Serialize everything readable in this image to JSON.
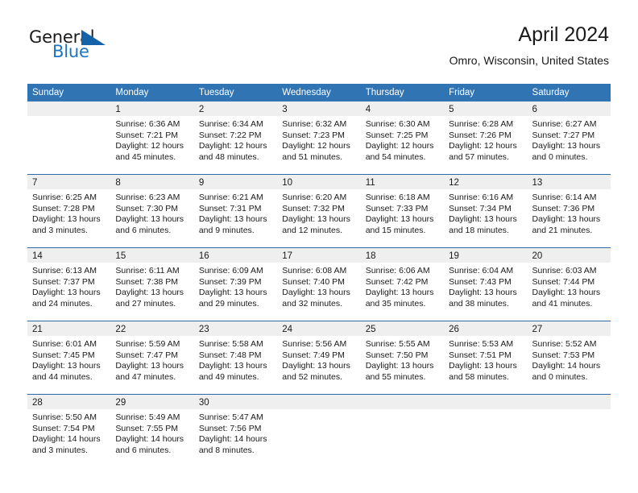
{
  "brand": {
    "name_top": "General",
    "name_bottom": "Blue",
    "accent_color": "#1e73be",
    "flag_color": "#1463a8"
  },
  "header": {
    "title": "April 2024",
    "location": "Omro, Wisconsin, United States"
  },
  "calendar": {
    "header_bg": "#3174b4",
    "day_band_bg": "#efefef",
    "weekdays": [
      "Sunday",
      "Monday",
      "Tuesday",
      "Wednesday",
      "Thursday",
      "Friday",
      "Saturday"
    ],
    "weeks": [
      [
        {
          "day": "",
          "lines": []
        },
        {
          "day": "1",
          "lines": [
            "Sunrise: 6:36 AM",
            "Sunset: 7:21 PM",
            "Daylight: 12 hours",
            "and 45 minutes."
          ]
        },
        {
          "day": "2",
          "lines": [
            "Sunrise: 6:34 AM",
            "Sunset: 7:22 PM",
            "Daylight: 12 hours",
            "and 48 minutes."
          ]
        },
        {
          "day": "3",
          "lines": [
            "Sunrise: 6:32 AM",
            "Sunset: 7:23 PM",
            "Daylight: 12 hours",
            "and 51 minutes."
          ]
        },
        {
          "day": "4",
          "lines": [
            "Sunrise: 6:30 AM",
            "Sunset: 7:25 PM",
            "Daylight: 12 hours",
            "and 54 minutes."
          ]
        },
        {
          "day": "5",
          "lines": [
            "Sunrise: 6:28 AM",
            "Sunset: 7:26 PM",
            "Daylight: 12 hours",
            "and 57 minutes."
          ]
        },
        {
          "day": "6",
          "lines": [
            "Sunrise: 6:27 AM",
            "Sunset: 7:27 PM",
            "Daylight: 13 hours",
            "and 0 minutes."
          ]
        }
      ],
      [
        {
          "day": "7",
          "lines": [
            "Sunrise: 6:25 AM",
            "Sunset: 7:28 PM",
            "Daylight: 13 hours",
            "and 3 minutes."
          ]
        },
        {
          "day": "8",
          "lines": [
            "Sunrise: 6:23 AM",
            "Sunset: 7:30 PM",
            "Daylight: 13 hours",
            "and 6 minutes."
          ]
        },
        {
          "day": "9",
          "lines": [
            "Sunrise: 6:21 AM",
            "Sunset: 7:31 PM",
            "Daylight: 13 hours",
            "and 9 minutes."
          ]
        },
        {
          "day": "10",
          "lines": [
            "Sunrise: 6:20 AM",
            "Sunset: 7:32 PM",
            "Daylight: 13 hours",
            "and 12 minutes."
          ]
        },
        {
          "day": "11",
          "lines": [
            "Sunrise: 6:18 AM",
            "Sunset: 7:33 PM",
            "Daylight: 13 hours",
            "and 15 minutes."
          ]
        },
        {
          "day": "12",
          "lines": [
            "Sunrise: 6:16 AM",
            "Sunset: 7:34 PM",
            "Daylight: 13 hours",
            "and 18 minutes."
          ]
        },
        {
          "day": "13",
          "lines": [
            "Sunrise: 6:14 AM",
            "Sunset: 7:36 PM",
            "Daylight: 13 hours",
            "and 21 minutes."
          ]
        }
      ],
      [
        {
          "day": "14",
          "lines": [
            "Sunrise: 6:13 AM",
            "Sunset: 7:37 PM",
            "Daylight: 13 hours",
            "and 24 minutes."
          ]
        },
        {
          "day": "15",
          "lines": [
            "Sunrise: 6:11 AM",
            "Sunset: 7:38 PM",
            "Daylight: 13 hours",
            "and 27 minutes."
          ]
        },
        {
          "day": "16",
          "lines": [
            "Sunrise: 6:09 AM",
            "Sunset: 7:39 PM",
            "Daylight: 13 hours",
            "and 29 minutes."
          ]
        },
        {
          "day": "17",
          "lines": [
            "Sunrise: 6:08 AM",
            "Sunset: 7:40 PM",
            "Daylight: 13 hours",
            "and 32 minutes."
          ]
        },
        {
          "day": "18",
          "lines": [
            "Sunrise: 6:06 AM",
            "Sunset: 7:42 PM",
            "Daylight: 13 hours",
            "and 35 minutes."
          ]
        },
        {
          "day": "19",
          "lines": [
            "Sunrise: 6:04 AM",
            "Sunset: 7:43 PM",
            "Daylight: 13 hours",
            "and 38 minutes."
          ]
        },
        {
          "day": "20",
          "lines": [
            "Sunrise: 6:03 AM",
            "Sunset: 7:44 PM",
            "Daylight: 13 hours",
            "and 41 minutes."
          ]
        }
      ],
      [
        {
          "day": "21",
          "lines": [
            "Sunrise: 6:01 AM",
            "Sunset: 7:45 PM",
            "Daylight: 13 hours",
            "and 44 minutes."
          ]
        },
        {
          "day": "22",
          "lines": [
            "Sunrise: 5:59 AM",
            "Sunset: 7:47 PM",
            "Daylight: 13 hours",
            "and 47 minutes."
          ]
        },
        {
          "day": "23",
          "lines": [
            "Sunrise: 5:58 AM",
            "Sunset: 7:48 PM",
            "Daylight: 13 hours",
            "and 49 minutes."
          ]
        },
        {
          "day": "24",
          "lines": [
            "Sunrise: 5:56 AM",
            "Sunset: 7:49 PM",
            "Daylight: 13 hours",
            "and 52 minutes."
          ]
        },
        {
          "day": "25",
          "lines": [
            "Sunrise: 5:55 AM",
            "Sunset: 7:50 PM",
            "Daylight: 13 hours",
            "and 55 minutes."
          ]
        },
        {
          "day": "26",
          "lines": [
            "Sunrise: 5:53 AM",
            "Sunset: 7:51 PM",
            "Daylight: 13 hours",
            "and 58 minutes."
          ]
        },
        {
          "day": "27",
          "lines": [
            "Sunrise: 5:52 AM",
            "Sunset: 7:53 PM",
            "Daylight: 14 hours",
            "and 0 minutes."
          ]
        }
      ],
      [
        {
          "day": "28",
          "lines": [
            "Sunrise: 5:50 AM",
            "Sunset: 7:54 PM",
            "Daylight: 14 hours",
            "and 3 minutes."
          ]
        },
        {
          "day": "29",
          "lines": [
            "Sunrise: 5:49 AM",
            "Sunset: 7:55 PM",
            "Daylight: 14 hours",
            "and 6 minutes."
          ]
        },
        {
          "day": "30",
          "lines": [
            "Sunrise: 5:47 AM",
            "Sunset: 7:56 PM",
            "Daylight: 14 hours",
            "and 8 minutes."
          ]
        },
        {
          "day": "",
          "lines": []
        },
        {
          "day": "",
          "lines": []
        },
        {
          "day": "",
          "lines": []
        },
        {
          "day": "",
          "lines": []
        }
      ]
    ]
  }
}
